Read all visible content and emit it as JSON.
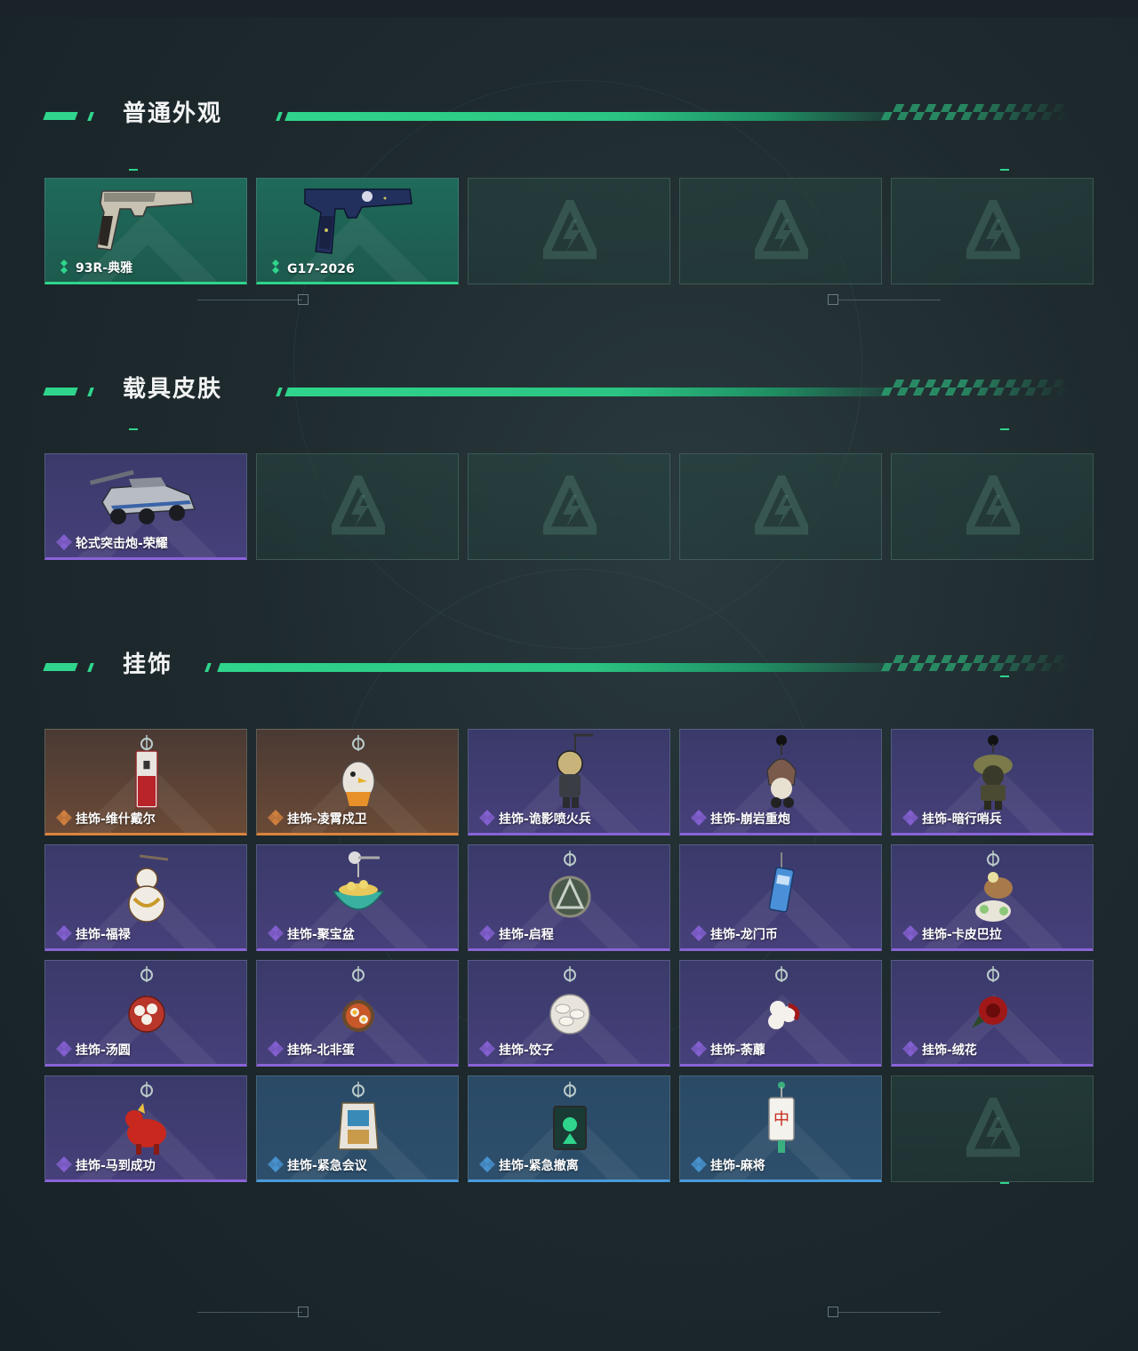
{
  "sections": [
    {
      "title": "普通外观",
      "cards": [
        {
          "label": "93R-典雅",
          "rarity": "green",
          "art": "pistol-tan"
        },
        {
          "label": "G17-2026",
          "rarity": "green",
          "art": "pistol-blue"
        },
        {
          "label": "",
          "rarity": "empty"
        },
        {
          "label": "",
          "rarity": "empty"
        },
        {
          "label": "",
          "rarity": "empty"
        }
      ]
    },
    {
      "title": "载具皮肤",
      "cards": [
        {
          "label": "轮式突击炮-荣耀",
          "rarity": "purple",
          "art": "vehicle"
        },
        {
          "label": "",
          "rarity": "empty"
        },
        {
          "label": "",
          "rarity": "empty"
        },
        {
          "label": "",
          "rarity": "empty"
        },
        {
          "label": "",
          "rarity": "empty"
        }
      ]
    },
    {
      "title": "挂饰",
      "cards": [
        {
          "label": "挂饰-维什戴尔",
          "rarity": "orange",
          "art": "charm-red-tag"
        },
        {
          "label": "挂饰-凌霄戍卫",
          "rarity": "orange",
          "art": "charm-chick"
        },
        {
          "label": "挂饰-诡影喷火兵",
          "rarity": "purple",
          "art": "charm-soldier"
        },
        {
          "label": "挂饰-崩岩重炮",
          "rarity": "purple",
          "art": "charm-gunner"
        },
        {
          "label": "挂饰-暗行哨兵",
          "rarity": "purple",
          "art": "charm-sentinel"
        },
        {
          "label": "挂饰-福禄",
          "rarity": "purple",
          "art": "charm-gourd"
        },
        {
          "label": "挂饰-聚宝盆",
          "rarity": "purple",
          "art": "charm-bowl"
        },
        {
          "label": "挂饰-启程",
          "rarity": "purple",
          "art": "charm-badge"
        },
        {
          "label": "挂饰-龙门币",
          "rarity": "purple",
          "art": "charm-card"
        },
        {
          "label": "挂饰-卡皮巴拉",
          "rarity": "purple",
          "art": "charm-capybara"
        },
        {
          "label": "挂饰-汤圆",
          "rarity": "purple",
          "art": "charm-tangyuan"
        },
        {
          "label": "挂饰-北非蛋",
          "rarity": "purple",
          "art": "charm-egg"
        },
        {
          "label": "挂饰-饺子",
          "rarity": "purple",
          "art": "charm-dumpling"
        },
        {
          "label": "挂饰-荼蘼",
          "rarity": "purple",
          "art": "charm-flower-white"
        },
        {
          "label": "挂饰-绒花",
          "rarity": "purple",
          "art": "charm-flower-red"
        },
        {
          "label": "挂饰-马到成功",
          "rarity": "purple",
          "art": "charm-horse"
        },
        {
          "label": "挂饰-紧急会议",
          "rarity": "blue",
          "art": "charm-meeting"
        },
        {
          "label": "挂饰-紧急撤离",
          "rarity": "blue",
          "art": "charm-exit"
        },
        {
          "label": "挂饰-麻将",
          "rarity": "blue",
          "art": "charm-mahjong"
        },
        {
          "label": "",
          "rarity": "empty"
        }
      ]
    }
  ],
  "colors": {
    "accent": "#2fd58c",
    "green": "#2fd58c",
    "purple": "#8a63d8",
    "orange": "#d9843e",
    "blue": "#4a9ad8"
  }
}
